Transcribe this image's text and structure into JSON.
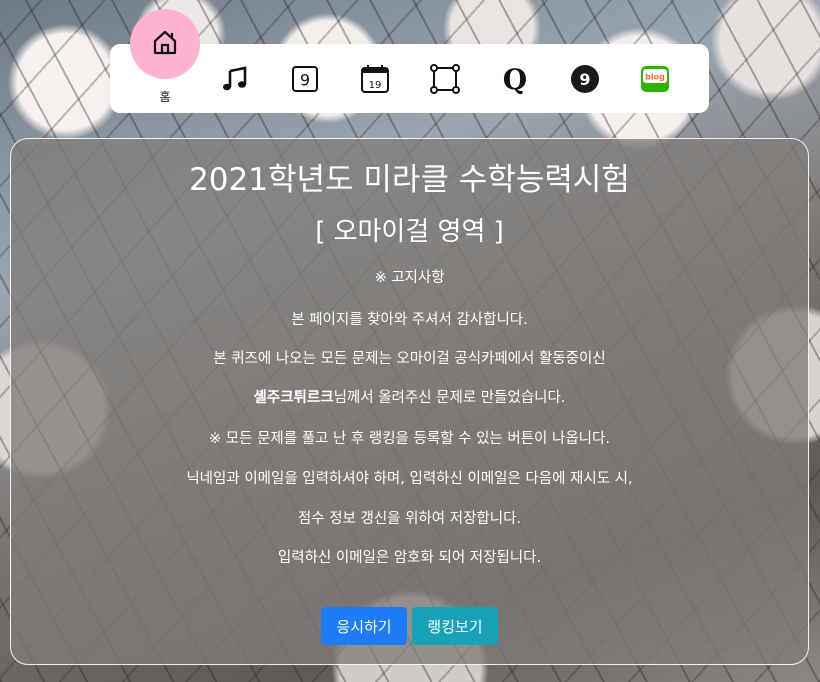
{
  "nav": {
    "home_label": "홈",
    "items": [
      {
        "icon": "home-icon"
      },
      {
        "icon": "music-note-icon"
      },
      {
        "icon": "nine-square-icon",
        "glyph": "9"
      },
      {
        "icon": "calendar-icon",
        "glyph": "19"
      },
      {
        "icon": "square-frame-icon"
      },
      {
        "icon": "q-letter-icon",
        "glyph": "Q"
      },
      {
        "icon": "nine-circle-icon",
        "glyph": "9"
      },
      {
        "icon": "blog-icon",
        "glyph": "blog"
      }
    ]
  },
  "panel": {
    "title": "2021학년도 미라클 수학능력시험",
    "subtitle": "[ 오마이걸 영역 ]",
    "notice_title": "※ 고지사항",
    "lines": [
      "본 페이지를 찾아와 주셔서 감사합니다.",
      "본 퀴즈에 나오는 모든 문제는 오마이걸 공식카페에서 활동중이신",
      "님께서 올려주신 문제로 만들었습니다.",
      "※ 모든 문제를 풀고 난 후 랭킹을 등록할 수 있는 버튼이 나옵니다.",
      "닉네임과 이메일을 입력하셔야 하며, 입력하신 이메일은 다음에 재시도 시,",
      "점수 정보 갱신을 위하여 저장합니다.",
      "입력하신 이메일은 암호화 되어 저장됩니다."
    ],
    "author": "셸주크튀르크"
  },
  "buttons": {
    "start": "응시하기",
    "ranking": "랭킹보기"
  },
  "colors": {
    "home_circle": "#ffb3d1",
    "primary": "#1e7df6",
    "info": "#17a2b8",
    "blog_green": "#2db400"
  }
}
